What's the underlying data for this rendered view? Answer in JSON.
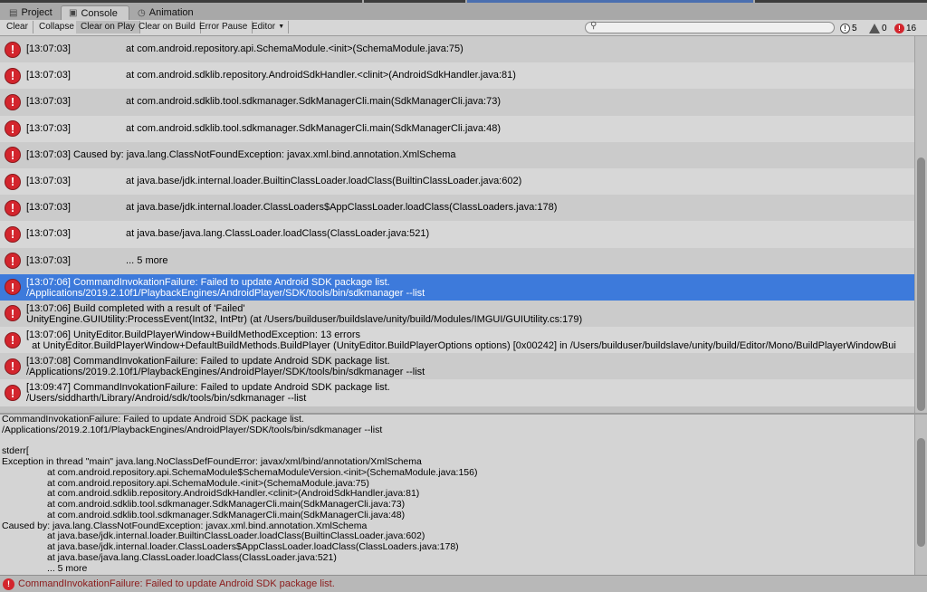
{
  "tabs": [
    {
      "label": "Project",
      "icon": "folder-icon"
    },
    {
      "label": "Console",
      "icon": "console-icon"
    },
    {
      "label": "Animation",
      "icon": "clock-icon"
    }
  ],
  "toolbar": {
    "clear": "Clear",
    "collapse": "Collapse",
    "clear_on_play": "Clear on Play",
    "clear_on_build": "Clear on Build",
    "error_pause": "Error Pause",
    "editor": "Editor",
    "search_placeholder": "",
    "info_count": "5",
    "warning_count": "0",
    "error_count": "16"
  },
  "log_entries": [
    {
      "line1": "[13:07:03]                    at com.android.repository.api.SchemaModule.<init>(SchemaModule.java:75)",
      "line2": ""
    },
    {
      "line1": "[13:07:03]                    at com.android.sdklib.repository.AndroidSdkHandler.<clinit>(AndroidSdkHandler.java:81)",
      "line2": ""
    },
    {
      "line1": "[13:07:03]                    at com.android.sdklib.tool.sdkmanager.SdkManagerCli.main(SdkManagerCli.java:73)",
      "line2": ""
    },
    {
      "line1": "[13:07:03]                    at com.android.sdklib.tool.sdkmanager.SdkManagerCli.main(SdkManagerCli.java:48)",
      "line2": ""
    },
    {
      "line1": "[13:07:03] Caused by: java.lang.ClassNotFoundException: javax.xml.bind.annotation.XmlSchema",
      "line2": ""
    },
    {
      "line1": "[13:07:03]                    at java.base/jdk.internal.loader.BuiltinClassLoader.loadClass(BuiltinClassLoader.java:602)",
      "line2": ""
    },
    {
      "line1": "[13:07:03]                    at java.base/jdk.internal.loader.ClassLoaders$AppClassLoader.loadClass(ClassLoaders.java:178)",
      "line2": ""
    },
    {
      "line1": "[13:07:03]                    at java.base/java.lang.ClassLoader.loadClass(ClassLoader.java:521)",
      "line2": ""
    },
    {
      "line1": "[13:07:03]                    ... 5 more",
      "line2": ""
    },
    {
      "line1": "[13:07:06] CommandInvokationFailure: Failed to update Android SDK package list.",
      "line2": "/Applications/2019.2.10f1/PlaybackEngines/AndroidPlayer/SDK/tools/bin/sdkmanager --list",
      "selected": true
    },
    {
      "line1": "[13:07:06] Build completed with a result of 'Failed'",
      "line2": "UnityEngine.GUIUtility:ProcessEvent(Int32, IntPtr) (at /Users/builduser/buildslave/unity/build/Modules/IMGUI/GUIUtility.cs:179)"
    },
    {
      "line1": "[13:07:06] UnityEditor.BuildPlayerWindow+BuildMethodException: 13 errors",
      "line2": "  at UnityEditor.BuildPlayerWindow+DefaultBuildMethods.BuildPlayer (UnityEditor.BuildPlayerOptions options) [0x00242] in /Users/builduser/buildslave/unity/build/Editor/Mono/BuildPlayerWindowBui"
    },
    {
      "line1": "[13:07:08] CommandInvokationFailure: Failed to update Android SDK package list.",
      "line2": "/Applications/2019.2.10f1/PlaybackEngines/AndroidPlayer/SDK/tools/bin/sdkmanager --list"
    },
    {
      "line1": "[13:09:47] CommandInvokationFailure: Failed to update Android SDK package list.",
      "line2": "/Users/siddharth/Library/Android/sdk/tools/bin/sdkmanager --list"
    }
  ],
  "detail_lines": [
    {
      "text": "CommandInvokationFailure: Failed to update Android SDK package list.",
      "indent": false
    },
    {
      "text": "/Applications/2019.2.10f1/PlaybackEngines/AndroidPlayer/SDK/tools/bin/sdkmanager --list",
      "indent": false
    },
    {
      "text": "",
      "indent": false
    },
    {
      "text": "stderr[",
      "indent": false
    },
    {
      "text": "Exception in thread \"main\" java.lang.NoClassDefFoundError: javax/xml/bind/annotation/XmlSchema",
      "indent": false
    },
    {
      "text": "at com.android.repository.api.SchemaModule$SchemaModuleVersion.<init>(SchemaModule.java:156)",
      "indent": true
    },
    {
      "text": "at com.android.repository.api.SchemaModule.<init>(SchemaModule.java:75)",
      "indent": true
    },
    {
      "text": "at com.android.sdklib.repository.AndroidSdkHandler.<clinit>(AndroidSdkHandler.java:81)",
      "indent": true
    },
    {
      "text": "at com.android.sdklib.tool.sdkmanager.SdkManagerCli.main(SdkManagerCli.java:73)",
      "indent": true
    },
    {
      "text": "at com.android.sdklib.tool.sdkmanager.SdkManagerCli.main(SdkManagerCli.java:48)",
      "indent": true
    },
    {
      "text": "Caused by: java.lang.ClassNotFoundException: javax.xml.bind.annotation.XmlSchema",
      "indent": false
    },
    {
      "text": "at java.base/jdk.internal.loader.BuiltinClassLoader.loadClass(BuiltinClassLoader.java:602)",
      "indent": true
    },
    {
      "text": "at java.base/jdk.internal.loader.ClassLoaders$AppClassLoader.loadClass(ClassLoaders.java:178)",
      "indent": true
    },
    {
      "text": "at java.base/java.lang.ClassLoader.loadClass(ClassLoader.java:521)",
      "indent": true
    },
    {
      "text": "... 5 more",
      "indent": true
    }
  ],
  "status_bar": {
    "message": "CommandInvokationFailure: Failed to update Android SDK package list."
  },
  "colors": {
    "error_red": "#d3252d",
    "selection_blue": "#3d7adb",
    "status_text": "#8b1a1a"
  }
}
